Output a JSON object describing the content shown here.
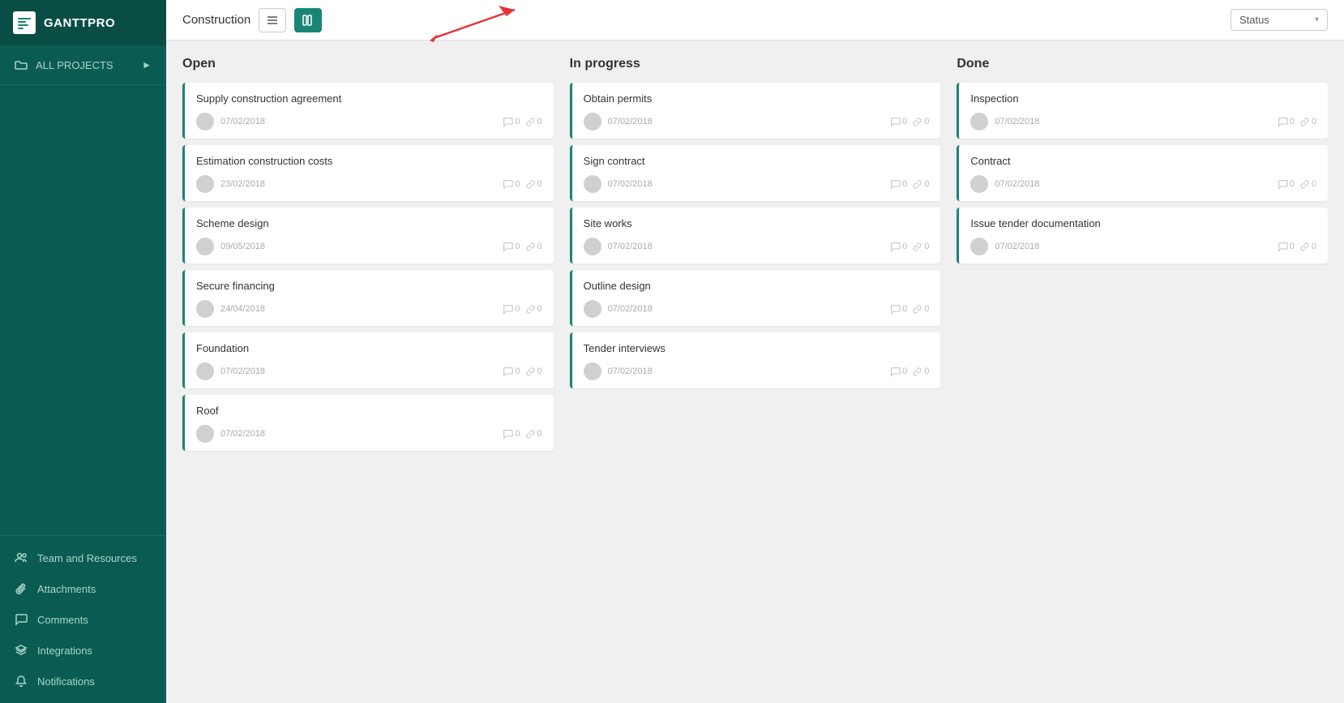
{
  "sidebar": {
    "logo": "GANTTPRO",
    "all_projects_label": "ALL PROJECTS",
    "bottom_items": [
      {
        "id": "team",
        "label": "Team and Resources",
        "icon": "people-icon"
      },
      {
        "id": "attachments",
        "label": "Attachments",
        "icon": "paperclip-icon"
      },
      {
        "id": "comments",
        "label": "Comments",
        "icon": "comment-icon"
      },
      {
        "id": "integrations",
        "label": "Integrations",
        "icon": "layers-icon"
      },
      {
        "id": "notifications",
        "label": "Notifications",
        "icon": "bell-icon"
      }
    ]
  },
  "topbar": {
    "project_title": "Construction",
    "view_list_label": "List view",
    "view_board_label": "Board view",
    "status_label": "Status",
    "status_caret": "▾"
  },
  "board": {
    "columns": [
      {
        "id": "open",
        "title": "Open",
        "tasks": [
          {
            "id": 1,
            "title": "Supply construction agreement",
            "date": "07/02/2018",
            "comments": 0,
            "links": 0
          },
          {
            "id": 2,
            "title": "Estimation construction costs",
            "date": "23/02/2018",
            "comments": 0,
            "links": 0
          },
          {
            "id": 3,
            "title": "Scheme design",
            "date": "09/05/2018",
            "comments": 0,
            "links": 0
          },
          {
            "id": 4,
            "title": "Secure financing",
            "date": "24/04/2018",
            "comments": 0,
            "links": 0
          },
          {
            "id": 5,
            "title": "Foundation",
            "date": "07/02/2018",
            "comments": 0,
            "links": 0
          },
          {
            "id": 6,
            "title": "Roof",
            "date": "07/02/2018",
            "comments": 0,
            "links": 0
          }
        ]
      },
      {
        "id": "in-progress",
        "title": "In progress",
        "tasks": [
          {
            "id": 7,
            "title": "Obtain permits",
            "date": "07/02/2018",
            "comments": 0,
            "links": 0
          },
          {
            "id": 8,
            "title": "Sign contract",
            "date": "07/02/2018",
            "comments": 0,
            "links": 0
          },
          {
            "id": 9,
            "title": "Site works",
            "date": "07/02/2018",
            "comments": 0,
            "links": 0
          },
          {
            "id": 10,
            "title": "Outline design",
            "date": "07/02/2018",
            "comments": 0,
            "links": 0
          },
          {
            "id": 11,
            "title": "Tender interviews",
            "date": "07/02/2018",
            "comments": 0,
            "links": 0
          }
        ]
      },
      {
        "id": "done",
        "title": "Done",
        "tasks": [
          {
            "id": 12,
            "title": "Inspection",
            "date": "07/02/2018",
            "comments": 0,
            "links": 0
          },
          {
            "id": 13,
            "title": "Contract",
            "date": "07/02/2018",
            "comments": 0,
            "links": 0
          },
          {
            "id": 14,
            "title": "Issue tender documentation",
            "date": "07/02/2018",
            "comments": 0,
            "links": 0
          }
        ]
      }
    ]
  }
}
